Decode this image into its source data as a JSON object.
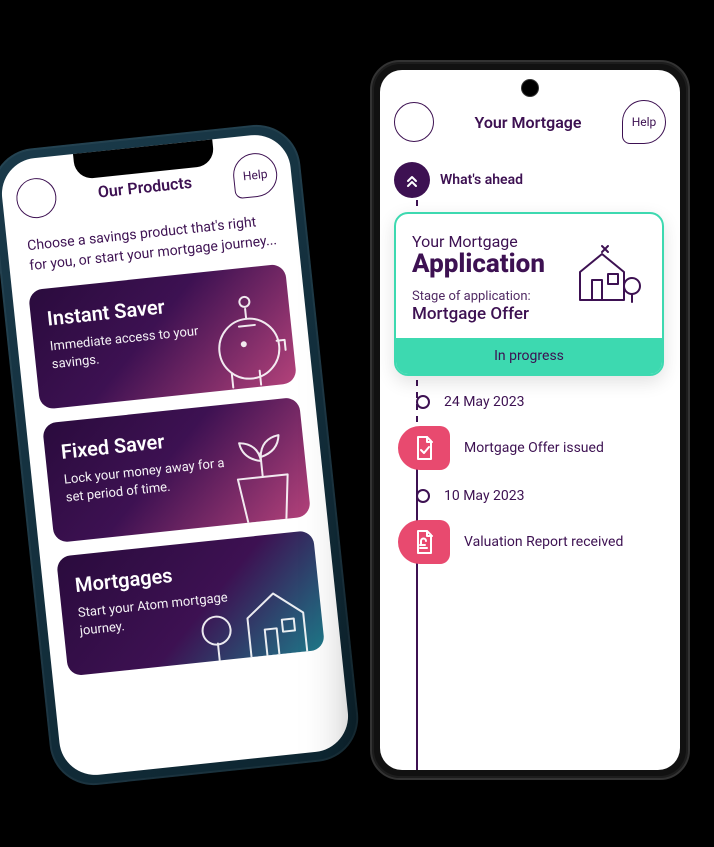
{
  "left": {
    "header": {
      "title": "Our Products",
      "help": "Help"
    },
    "intro": "Choose a savings product that's right for you, or start your mortgage journey...",
    "cards": [
      {
        "title": "Instant Saver",
        "desc": "Immediate access to your savings."
      },
      {
        "title": "Fixed Saver",
        "desc": "Lock your money away for a set period of time."
      },
      {
        "title": "Mortgages",
        "desc": "Start your Atom mortgage journey."
      }
    ]
  },
  "right": {
    "header": {
      "title": "Your Mortgage",
      "help": "Help"
    },
    "ahead_label": "What's ahead",
    "application": {
      "line1": "Your Mortgage",
      "line2": "Application",
      "stage_label": "Stage of application:",
      "stage_value": "Mortgage Offer",
      "status": "In progress"
    },
    "timeline": [
      {
        "type": "date",
        "text": "24 May 2023"
      },
      {
        "type": "event",
        "text": "Mortgage Offer issued",
        "icon": "doc-check"
      },
      {
        "type": "date",
        "text": "10 May 2023"
      },
      {
        "type": "event",
        "text": "Valuation Report received",
        "icon": "doc-pound"
      }
    ]
  }
}
